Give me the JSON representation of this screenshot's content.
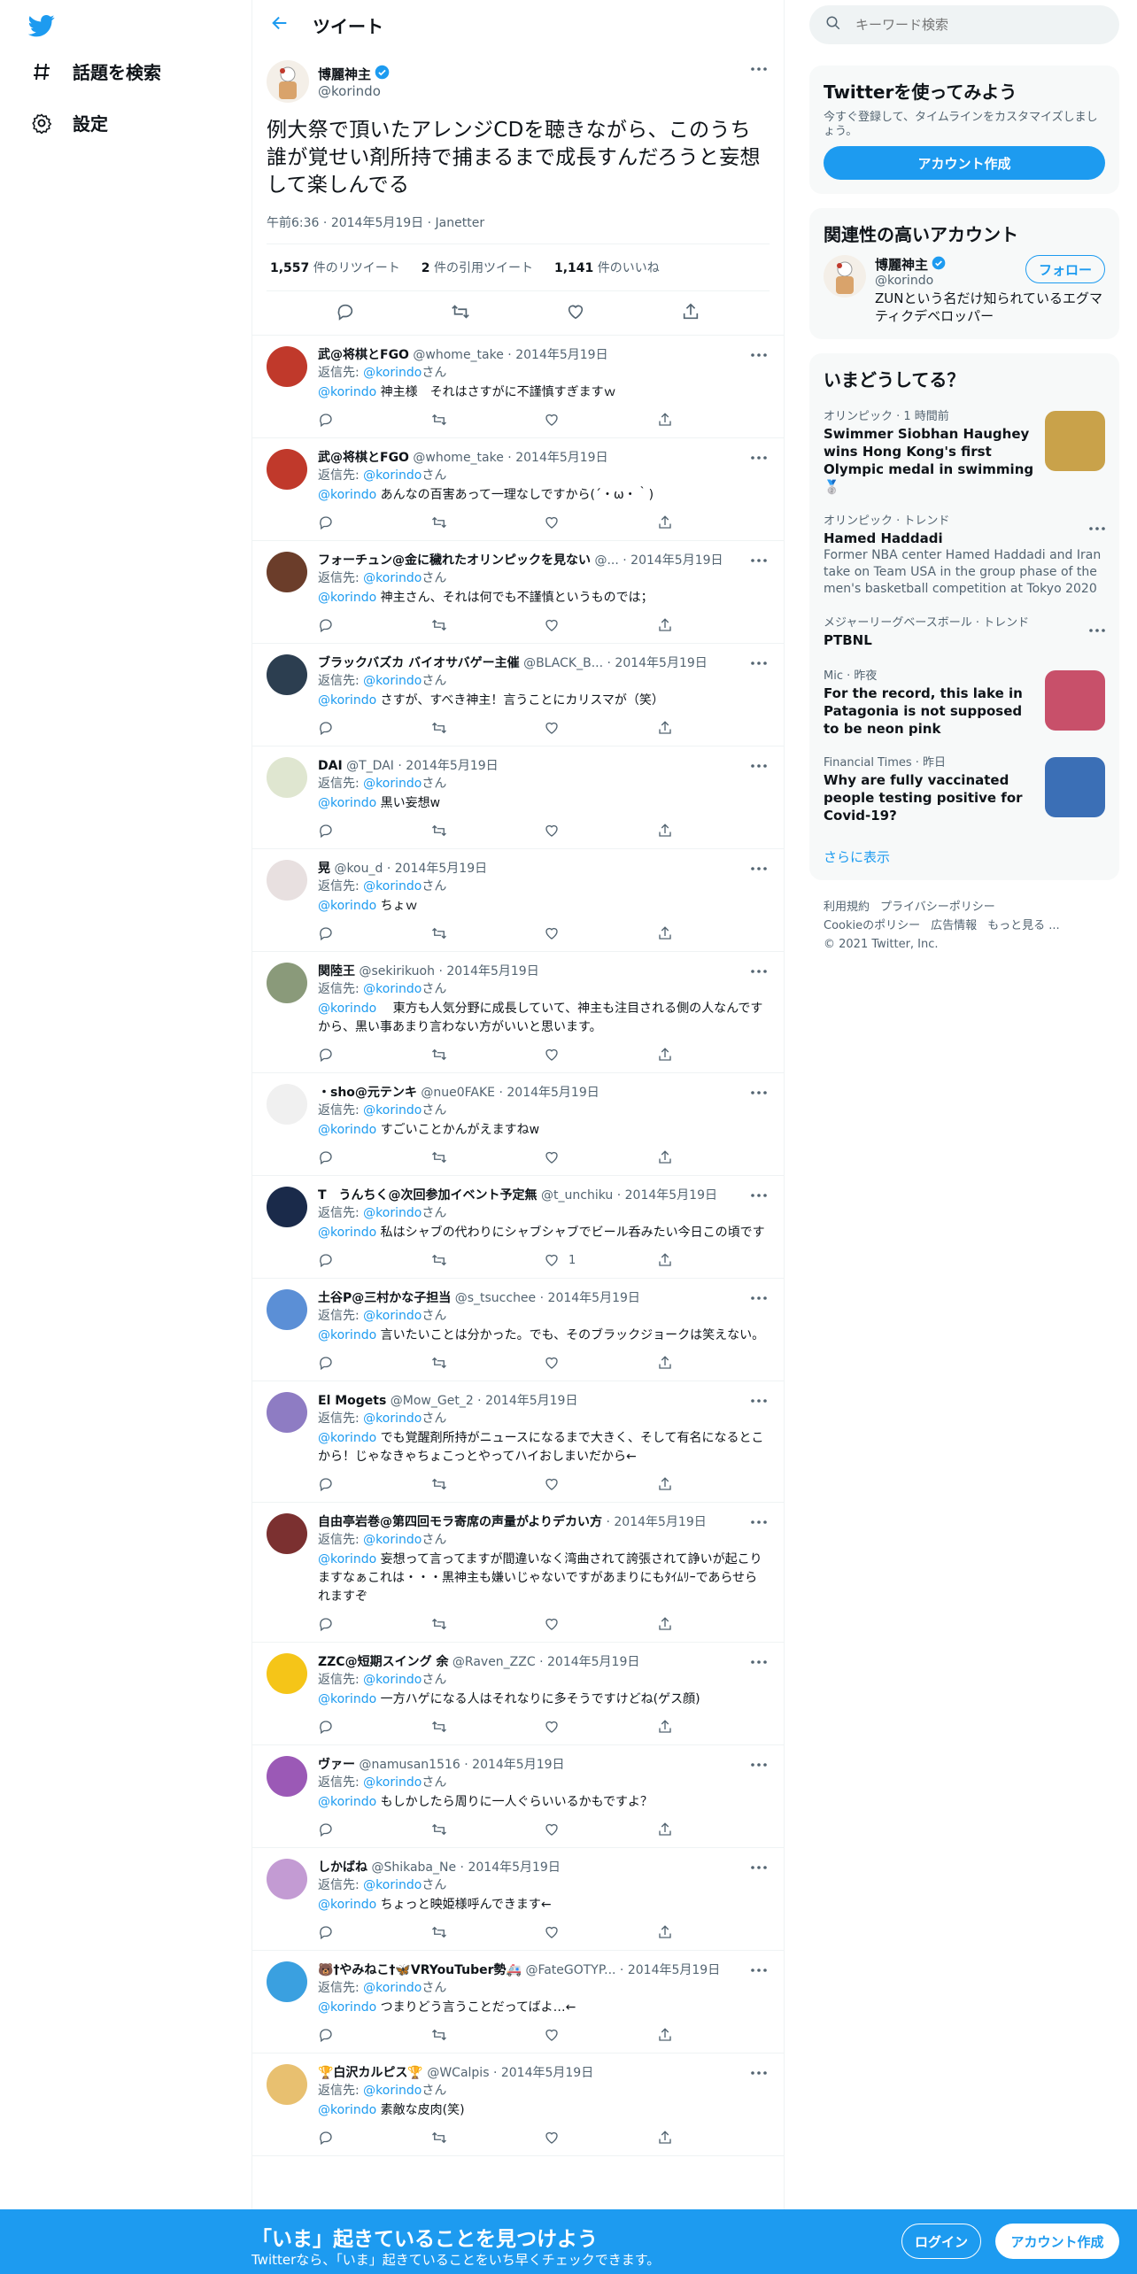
{
  "nav": {
    "explore_label": "話題を検索",
    "settings_label": "設定"
  },
  "header": {
    "title": "ツイート"
  },
  "focus_tweet": {
    "display_name": "博麗神主",
    "screen_name": "@korindo",
    "text": "例大祭で頂いたアレンジCDを聴きながら、このうち誰が覚せい剤所持で捕まるまで成長すんだろうと妄想して楽しんでる",
    "time": "午前6:36",
    "date": "2014年5月19日",
    "source": "Janetter",
    "retweets": "1,557",
    "retweets_label": "件のリツイート",
    "quotes": "2",
    "quotes_label": "件の引用ツイート",
    "likes": "1,141",
    "likes_label": "件のいいね"
  },
  "reply_to_label": "返信先: ",
  "reply_to_user": "@korindo",
  "reply_to_suffix": "さん",
  "replies": [
    {
      "name": "武@将棋とFGO",
      "handle": "@whome_take",
      "date": "2014年5月19日",
      "mention": "@korindo",
      "text": " 神主様　それはさすがに不謹慎すぎますｗ",
      "likes": "",
      "color": "#c0392b"
    },
    {
      "name": "武@将棋とFGO",
      "handle": "@whome_take",
      "date": "2014年5月19日",
      "mention": "@korindo",
      "text": " あんなの百害あって一理なしですから(´・ω・｀)",
      "likes": "",
      "color": "#c0392b"
    },
    {
      "name": "フォーチュン@金に穢れたオリンピックを見ない",
      "handle": "@...",
      "date": "2014年5月19日",
      "mention": "@korindo",
      "text": " 神主さん、それは何でも不謹慎というものでは；",
      "likes": "",
      "color": "#6b3d2a"
    },
    {
      "name": "ブラックバズカ バイオサバゲー主催",
      "handle": "@BLACK_B...",
      "date": "2014年5月19日",
      "mention": "@korindo",
      "text": " さすが、すべき神主！言うことにカリスマが（笑）",
      "likes": "",
      "color": "#2c3e50"
    },
    {
      "name": "DAI",
      "handle": "@T_DAI",
      "date": "2014年5月19日",
      "mention": "@korindo",
      "text": " 黒い妄想w",
      "likes": "",
      "color": "#dfe6d0"
    },
    {
      "name": "晃",
      "handle": "@kou_d",
      "date": "2014年5月19日",
      "mention": "@korindo",
      "text": " ちょｗ",
      "likes": "",
      "color": "#e8e0e0"
    },
    {
      "name": "関陸王",
      "handle": "@sekirikuoh",
      "date": "2014年5月19日",
      "mention": "@korindo",
      "text": " 　東方も人気分野に成長していて、神主も注目される側の人なんですから、黒い事あまり言わない方がいいと思います。",
      "likes": "",
      "color": "#8a9a7a"
    },
    {
      "name": "・sho@元テンキ",
      "handle": "@nue0FAKE",
      "date": "2014年5月19日",
      "mention": "@korindo",
      "text": " すごいことかんがえますねw",
      "likes": "",
      "color": "#f0f0f0"
    },
    {
      "name": "T　うんちく@次回参加イベント予定無",
      "handle": "@t_unchiku",
      "date": "2014年5月19日",
      "mention": "@korindo",
      "text": " 私はシャブの代わりにシャブシャブでビール呑みたい今日この頃です",
      "likes": "1",
      "color": "#1a2a4a"
    },
    {
      "name": "土谷P@三村かな子担当",
      "handle": "@s_tsucchee",
      "date": "2014年5月19日",
      "mention": "@korindo",
      "text": " 言いたいことは分かった。でも、そのブラックジョークは笑えない。",
      "likes": "",
      "color": "#5b8fd6"
    },
    {
      "name": "El Mogets",
      "handle": "@Mow_Get_2",
      "date": "2014年5月19日",
      "mention": "@korindo",
      "text": " でも覚醒剤所持がニュースになるまで大きく、そして有名になるとこから！じゃなきゃちょこっとやってハイおしまいだから←",
      "likes": "",
      "color": "#8e7cc3"
    },
    {
      "name": "自由亭岩巻@第四回モラ寄席の声量がよりデカい方",
      "handle": "",
      "date": "2014年5月19日",
      "mention": "@korindo",
      "text": " 妄想って言ってますが間違いなく湾曲されて誇張されて諍いが起こりますなぁこれは・・・黒神主も嫌いじゃないですがあまりにもﾀｲﾑﾘｰであらせられますぞ",
      "likes": "",
      "color": "#7b3030"
    },
    {
      "name": "ZZC@短期スイング 余",
      "handle": "@Raven_ZZC",
      "date": "2014年5月19日",
      "mention": "@korindo",
      "text": " 一方ハゲになる人はそれなりに多そうですけどね(ゲス顔)",
      "likes": "",
      "color": "#f5c518"
    },
    {
      "name": "ヴァー",
      "handle": "@namusan1516",
      "date": "2014年5月19日",
      "mention": "@korindo",
      "text": " もしかしたら周りに一人ぐらいいるかもですよ？",
      "likes": "",
      "color": "#9b59b6"
    },
    {
      "name": "しかばね",
      "handle": "@Shikaba_Ne",
      "date": "2014年5月19日",
      "mention": "@korindo",
      "text": " ちょっと映姫様呼んできます←",
      "likes": "",
      "color": "#c39bd3"
    },
    {
      "name": "🐻†やみねこ†🦋VRYouTuber勢🚑",
      "handle": "@FateGOTYP...",
      "date": "2014年5月19日",
      "mention": "@korindo",
      "text": " つまりどう言うことだってばよ…←",
      "likes": "",
      "color": "#3aa0e0"
    },
    {
      "name": "🏆白沢カルピス🏆",
      "handle": "@WCalpis",
      "date": "2014年5月19日",
      "mention": "@korindo",
      "text": " 素敵な皮肉(笑)",
      "likes": "",
      "color": "#e8c070"
    }
  ],
  "search": {
    "placeholder": "キーワード検索"
  },
  "signup_card": {
    "title": "Twitterを使ってみよう",
    "text": "今すぐ登録して、タイムラインをカスタマイズしましょう。",
    "button": "アカウント作成"
  },
  "related": {
    "title": "関連性の高いアカウント",
    "name": "博麗神主",
    "handle": "@korindo",
    "bio": "ZUNという名だけ知られているエグマティクデベロッパー",
    "follow": "フォロー"
  },
  "trends": {
    "title": "いまどうしてる？",
    "items": [
      {
        "meta": "オリンピック · 1 時間前",
        "name": "Swimmer Siobhan Haughey wins Hong Kong's first Olympic medal in swimming 🥈",
        "desc": "",
        "image": true,
        "more": false,
        "img_color": "#c9a24a"
      },
      {
        "meta": "オリンピック · トレンド",
        "name": "Hamed Haddadi",
        "desc": "Former NBA center Hamed Haddadi and Iran take on Team USA in the group phase of the men's basketball competition at Tokyo 2020",
        "image": false,
        "more": true
      },
      {
        "meta": "メジャーリーグベースボール · トレンド",
        "name": "PTBNL",
        "desc": "",
        "image": false,
        "more": true
      },
      {
        "meta": "Mic · 昨夜",
        "name": "For the record, this lake in Patagonia is not supposed to be neon pink",
        "desc": "",
        "image": true,
        "more": false,
        "img_color": "#c8506a"
      },
      {
        "meta": "Financial Times · 昨日",
        "name": "Why are fully vaccinated people testing positive for Covid-19?",
        "desc": "",
        "image": true,
        "more": false,
        "img_color": "#3b6fb6"
      }
    ],
    "show_more": "さらに表示"
  },
  "footer": {
    "links1": [
      "利用規約",
      "プライバシーポリシー"
    ],
    "links2": [
      "Cookieのポリシー",
      "広告情報",
      "もっと見る ..."
    ],
    "copyright": "© 2021 Twitter, Inc."
  },
  "bottom_bar": {
    "title": "「いま」起きていることを見つけよう",
    "subtitle": "Twitterなら、「いま」起きていることをいち早くチェックできます。",
    "login": "ログイン",
    "signup": "アカウント作成"
  }
}
